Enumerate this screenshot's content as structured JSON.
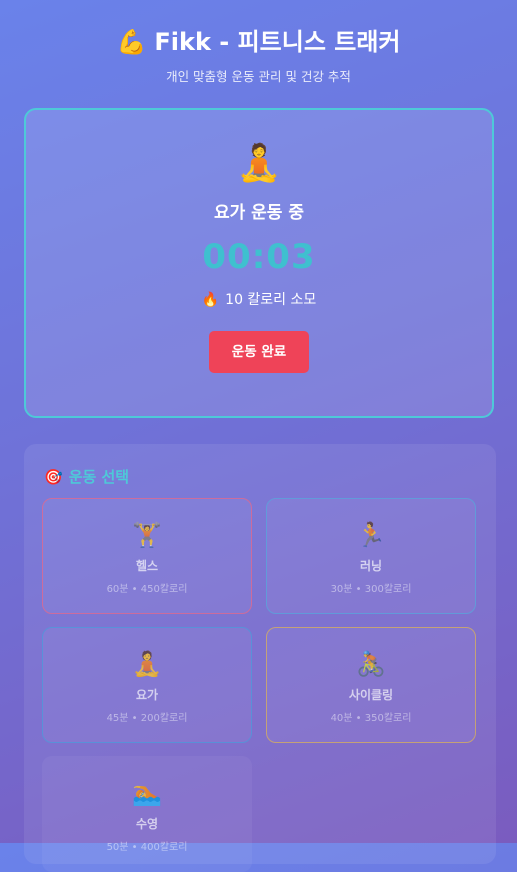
{
  "header": {
    "title_emoji": "💪",
    "title": "Fikk - 피트니스 트래커",
    "subtitle": "개인 맞춤형 운동 관리 및 건강 추적"
  },
  "active_workout": {
    "icon": "🧘",
    "icon_name": "yoga-icon",
    "label": "요가 운동 중",
    "timer": "00:03",
    "calorie_icon": "🔥",
    "calories_text": "10 칼로리 소모",
    "finish_button": "운동 완료"
  },
  "selection": {
    "title_icon": "🎯",
    "title": "운동 선택",
    "workouts": [
      {
        "icon": "🏋️",
        "name": "헬스",
        "meta": "60분 • 450칼로리"
      },
      {
        "icon": "🏃",
        "name": "러닝",
        "meta": "30분 • 300칼로리"
      },
      {
        "icon": "🧘",
        "name": "요가",
        "meta": "45분 • 200칼로리"
      },
      {
        "icon": "🚴",
        "name": "사이클링",
        "meta": "40분 • 350칼로리"
      },
      {
        "icon": "🏊",
        "name": "수영",
        "meta": "50분 • 400칼로리"
      }
    ]
  },
  "colors": {
    "accent": "#4ec9d8",
    "finish_button": "#ef4358",
    "timer": "#3fc0cf"
  }
}
